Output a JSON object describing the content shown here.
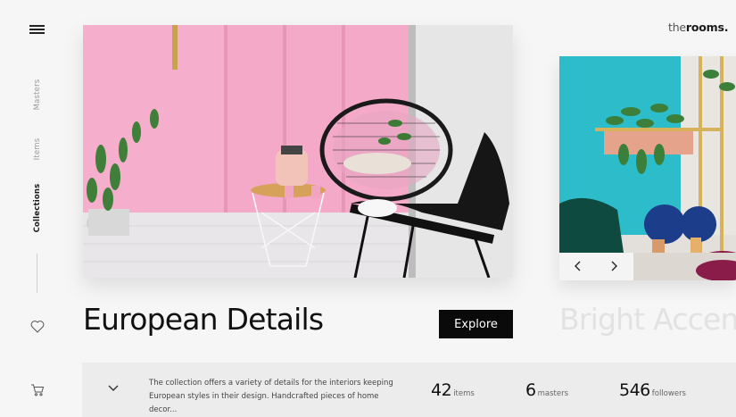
{
  "brand": {
    "logo_thin": "the",
    "logo_bold": "rooms."
  },
  "sidebar": {
    "menu_icon": "menu-icon",
    "nav": [
      {
        "label": "Masters",
        "active": false
      },
      {
        "label": "Items",
        "active": false
      },
      {
        "label": "Collections",
        "active": true
      }
    ],
    "favorite_icon": "heart-icon",
    "cart_icon": "cart-icon"
  },
  "collection": {
    "title": "European Details",
    "explore_label": "Explore",
    "next_title": "Bright Accent",
    "description": "The collection offers a variety of details for the interiors keeping European styles in their design. Handcrafted pieces of home decor...",
    "stats": [
      {
        "value": "42",
        "label": "items"
      },
      {
        "value": "6",
        "label": "masters"
      },
      {
        "value": "546",
        "label": "followers"
      }
    ]
  },
  "colors": {
    "accent": "#0a0a0a",
    "hero_wall": "#f0a6c5",
    "next_wall": "#2fb8c8"
  }
}
